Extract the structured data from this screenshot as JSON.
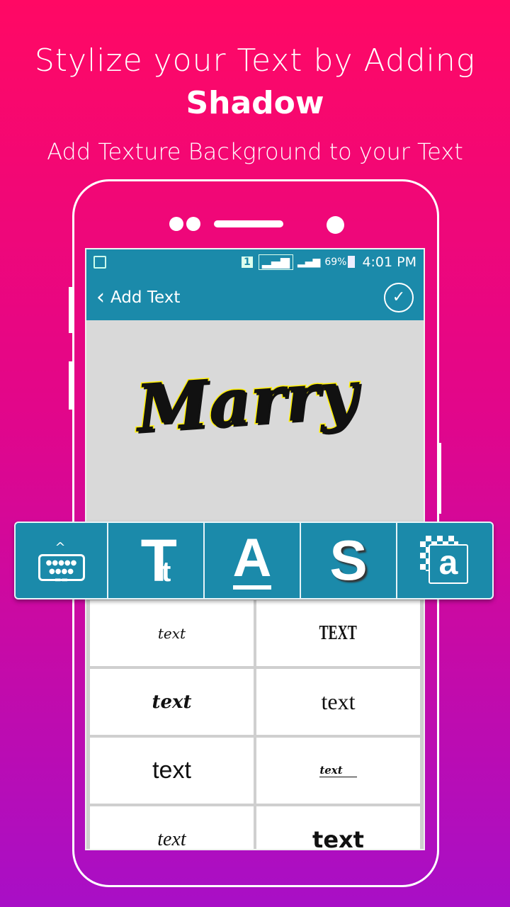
{
  "promo": {
    "line1": "Stylize your Text by Adding",
    "line2": "Shadow",
    "line3": "Add Texture Background to your Text"
  },
  "status_bar": {
    "sim": "1",
    "battery": "69%",
    "time": "4:01 PM"
  },
  "app_bar": {
    "title": "Add Text"
  },
  "canvas": {
    "text": "Marry"
  },
  "toolbar": {
    "tools": [
      {
        "icon": "keyboard-icon"
      },
      {
        "icon": "font-size-icon",
        "glyph": "T",
        "sub": "t"
      },
      {
        "icon": "text-color-icon",
        "glyph": "A"
      },
      {
        "icon": "shadow-icon",
        "glyph": "S"
      },
      {
        "icon": "texture-icon",
        "glyph": "a"
      }
    ]
  },
  "fonts": [
    "text",
    "TEXT",
    "text",
    "text",
    "text",
    "text",
    "text",
    "text"
  ],
  "colors": {
    "primary": "#1b8aaa",
    "text_fill": "#111111",
    "text_stroke": "#ffef00"
  }
}
